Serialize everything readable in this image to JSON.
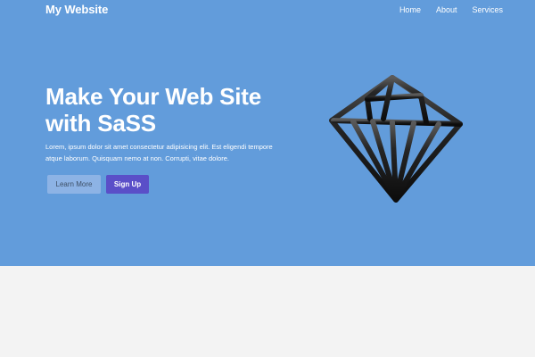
{
  "navbar": {
    "brand": "My Website",
    "links": [
      "Home",
      "About",
      "Services"
    ]
  },
  "hero": {
    "headline_line1": "Make Your Web Site",
    "headline_line2": "with SaSS",
    "lead": "Lorem, ipsum dolor sit amet consectetur adipisicing elit. Est eligendi tempore atque laborum. Quisquam nemo at non. Corrupti, vitae dolore.",
    "buttons": {
      "learn_more": "Learn More",
      "sign_up": "Sign Up"
    },
    "illustration_icon": "diamond-icon"
  },
  "colors": {
    "hero_background": "#629cdb",
    "page_background": "#f3f3f3",
    "primary_button": "#5a4fc8",
    "secondary_button": "#8db3e5",
    "text_light": "#ffffff"
  }
}
